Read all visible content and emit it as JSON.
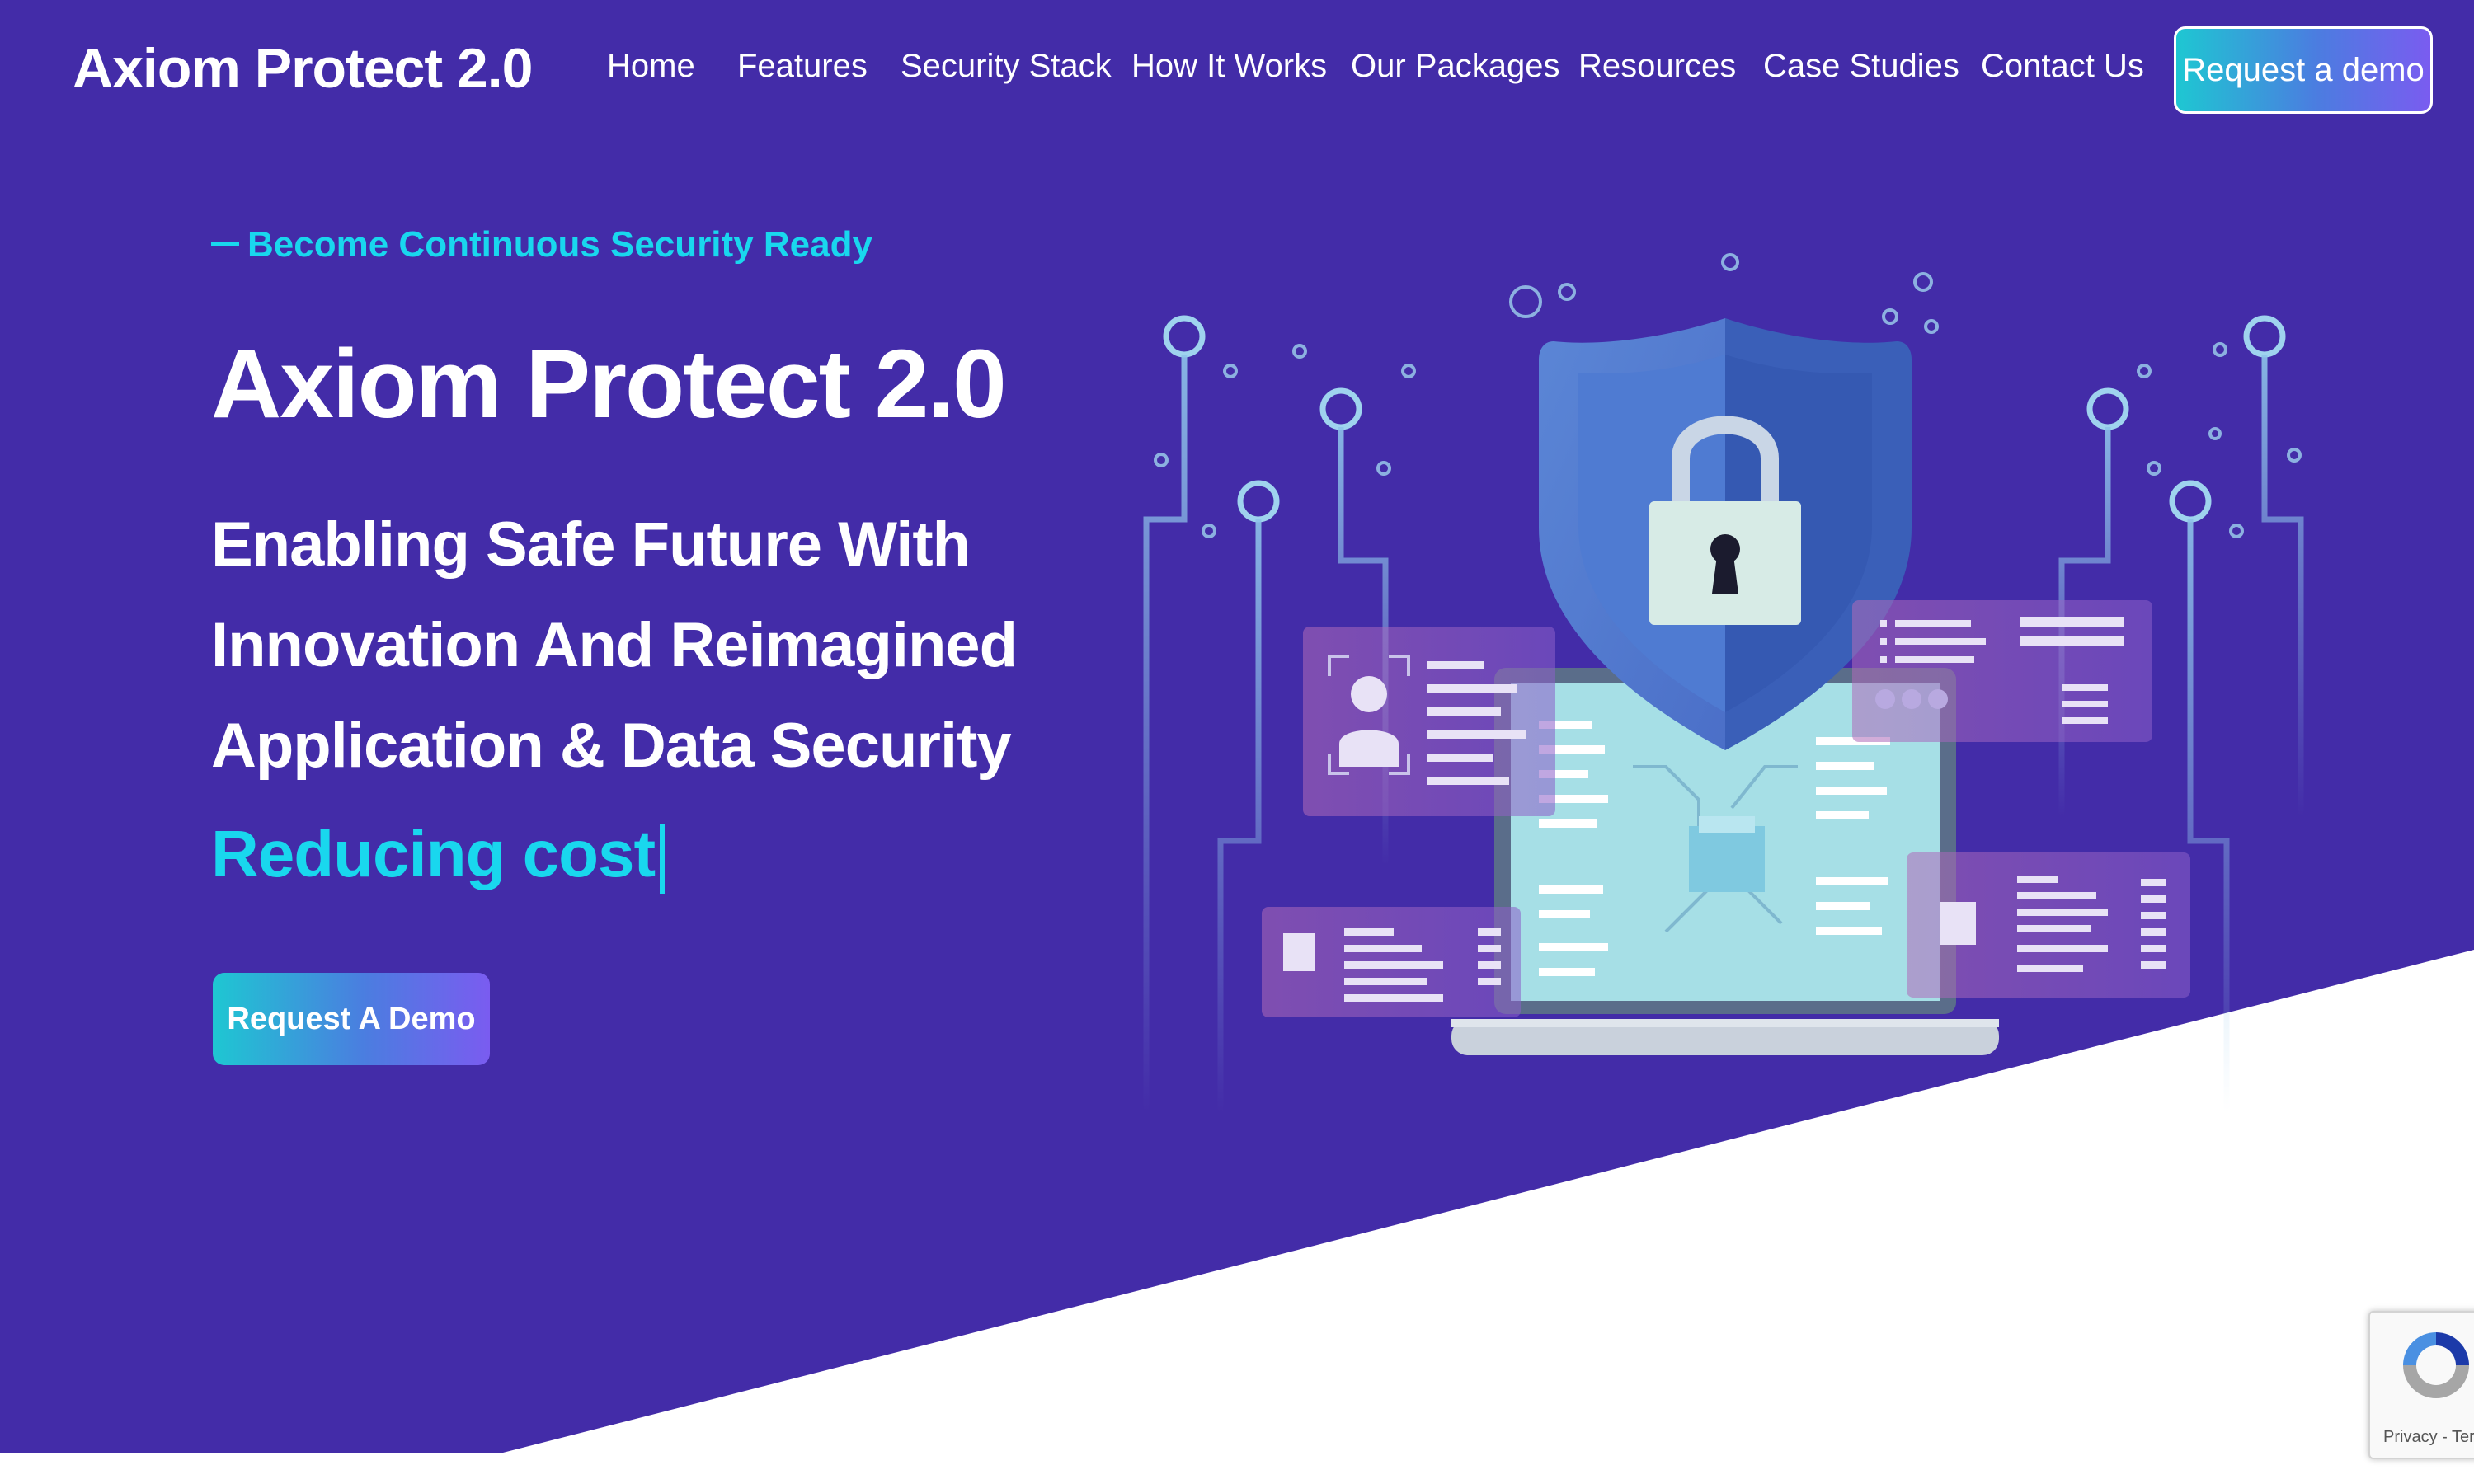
{
  "colors": {
    "hero_bg": "#432ca8",
    "accent_cyan": "#19d7ee",
    "white": "#ffffff",
    "cta_gradient_start": "#1ec7d2",
    "cta_gradient_end": "#7a5cf0"
  },
  "brand": {
    "name": "Axiom Protect 2.0"
  },
  "nav": {
    "items": [
      {
        "label": "Home"
      },
      {
        "label": "Features"
      },
      {
        "label": "Security Stack"
      },
      {
        "label": "How It Works"
      },
      {
        "label": "Our Packages"
      },
      {
        "label": "Resources"
      },
      {
        "label": "Case Studies"
      },
      {
        "label": "Contact Us"
      }
    ],
    "cta_label": "Request a demo"
  },
  "hero": {
    "eyebrow": "Become Continuous Security Ready",
    "title": "Axiom Protect 2.0",
    "subtitle": "Enabling Safe Future With Innovation And Reimagined Application & Data Security",
    "typed_text": "Reducing cost",
    "cta_label": "Request A Demo"
  },
  "illustration": {
    "icons": [
      "shield-icon",
      "padlock-icon",
      "laptop-icon",
      "user-profile-card-icon",
      "circuit-lines"
    ]
  },
  "recaptcha": {
    "label": "Privacy - Terms"
  }
}
